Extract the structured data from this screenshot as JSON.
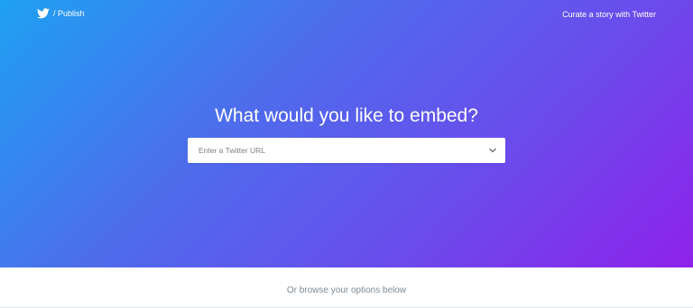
{
  "header": {
    "brand_separator": "/ Publish",
    "curate_link": "Curate a story with Twitter"
  },
  "hero": {
    "headline": "What would you like to embed?",
    "url_input": {
      "value": "",
      "placeholder": "Enter a Twitter URL"
    }
  },
  "footer": {
    "browse_text": "Or browse your options below"
  },
  "colors": {
    "gradient_start": "#1ea1f2",
    "gradient_end": "#8e22ea",
    "text_on_hero": "#ffffff",
    "muted_text": "#7d8a94"
  },
  "icons": {
    "logo": "twitter-bird-icon",
    "dropdown": "chevron-down-icon"
  }
}
